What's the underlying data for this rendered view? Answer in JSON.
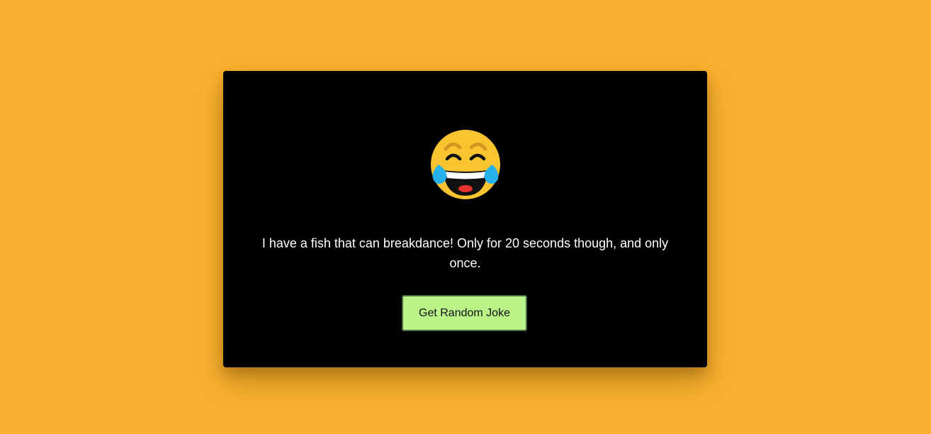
{
  "theme": {
    "background": "#fbb12f",
    "card_background": "#000000",
    "button_background": "#baf489",
    "text_color": "#ffffff"
  },
  "card": {
    "icon": "face-with-tears-of-joy-icon",
    "joke_text": "I have a fish that can breakdance! Only for 20 seconds though, and only once.",
    "button_label": "Get Random Joke"
  }
}
